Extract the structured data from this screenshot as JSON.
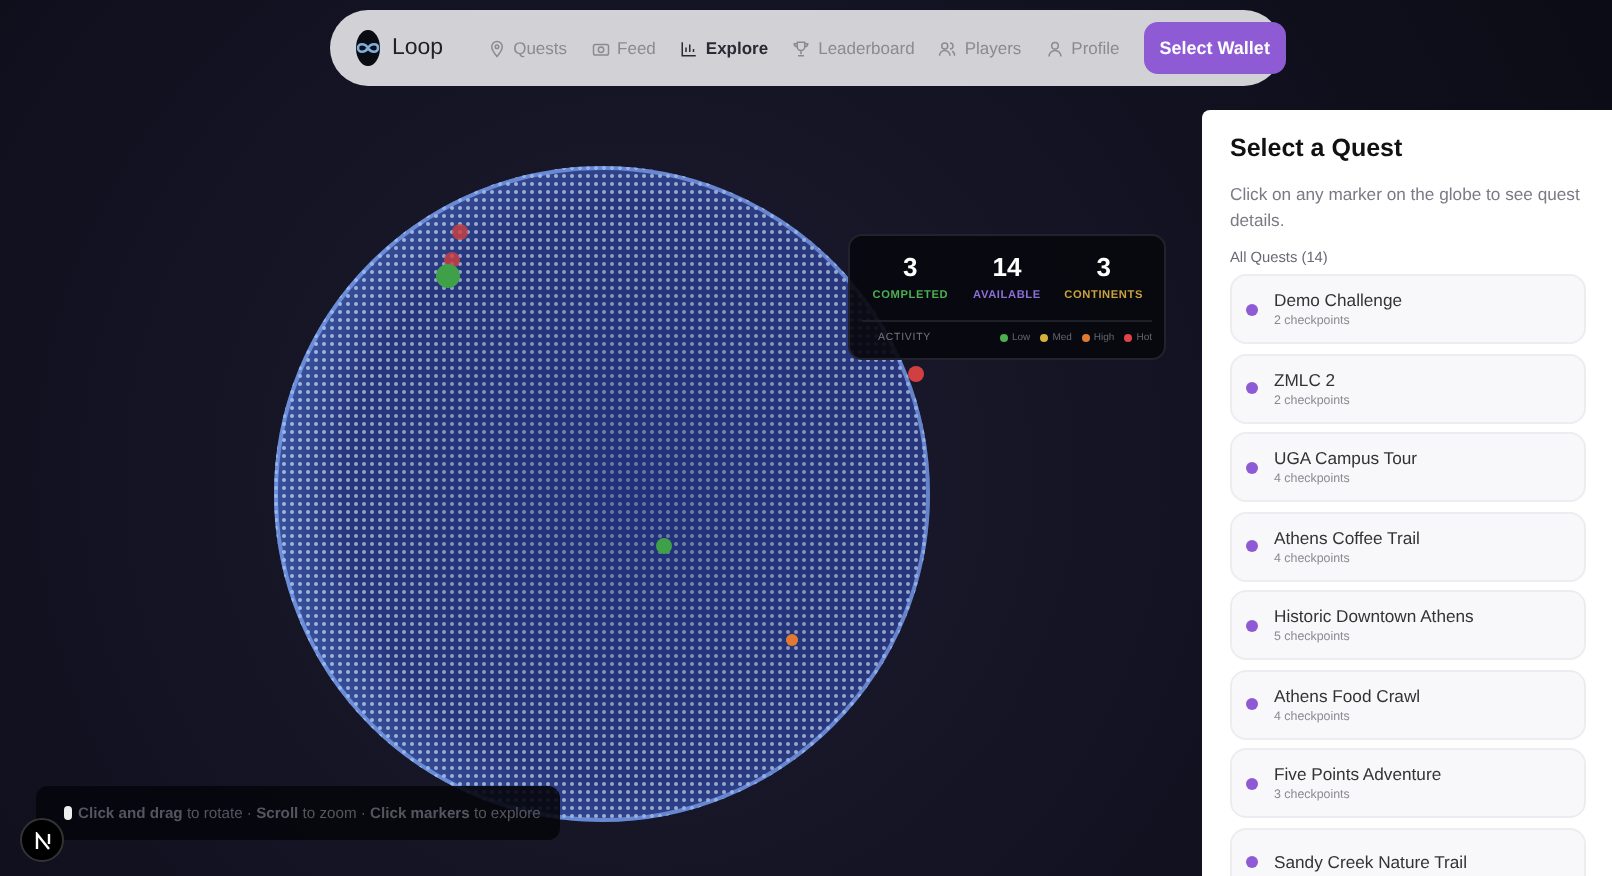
{
  "nav": {
    "brand": "Loop",
    "items": [
      {
        "label": "Quests",
        "kind": "pin",
        "selected": false
      },
      {
        "label": "Feed",
        "kind": "camera",
        "selected": false
      },
      {
        "label": "Explore",
        "kind": "chart",
        "selected": true
      },
      {
        "label": "Leaderboard",
        "kind": "trophy",
        "selected": false
      },
      {
        "label": "Players",
        "kind": "users",
        "selected": false
      },
      {
        "label": "Profile",
        "kind": "user",
        "selected": false
      }
    ],
    "wallet_button": "Select Wallet"
  },
  "stats": {
    "items": [
      {
        "value": "3",
        "label": "COMPLETED",
        "color": "#4caf50"
      },
      {
        "value": "14",
        "label": "AVAILABLE",
        "color": "#8b6fd6"
      },
      {
        "value": "3",
        "label": "CONTINENTS",
        "color": "#c9a13c"
      }
    ],
    "activity_label": "ACTIVITY",
    "legend": [
      {
        "label": "Low",
        "color": "#4caf50"
      },
      {
        "label": "Med",
        "color": "#d4b23a"
      },
      {
        "label": "High",
        "color": "#e07a30"
      },
      {
        "label": "Hot",
        "color": "#e0454a"
      }
    ]
  },
  "hint": "**Click and drag** to rotate · **Scroll** to zoom · **Click markers** to explore",
  "panel": {
    "title": "Select a Quest",
    "description": "Click on any marker on the globe to see quest details.",
    "list_heading": "All Quests (14)",
    "quests": [
      {
        "name": "Demo Challenge",
        "detail": "2 checkpoints"
      },
      {
        "name": "ZMLC 2",
        "detail": "2 checkpoints"
      },
      {
        "name": "UGA Campus Tour",
        "detail": "4 checkpoints"
      },
      {
        "name": "Athens Coffee Trail",
        "detail": "4 checkpoints"
      },
      {
        "name": "Historic Downtown Athens",
        "detail": "5 checkpoints"
      },
      {
        "name": "Athens Food Crawl",
        "detail": "4 checkpoints"
      },
      {
        "name": "Five Points Adventure",
        "detail": "3 checkpoints"
      },
      {
        "name": "Sandy Creek Nature Trail"
      }
    ]
  }
}
